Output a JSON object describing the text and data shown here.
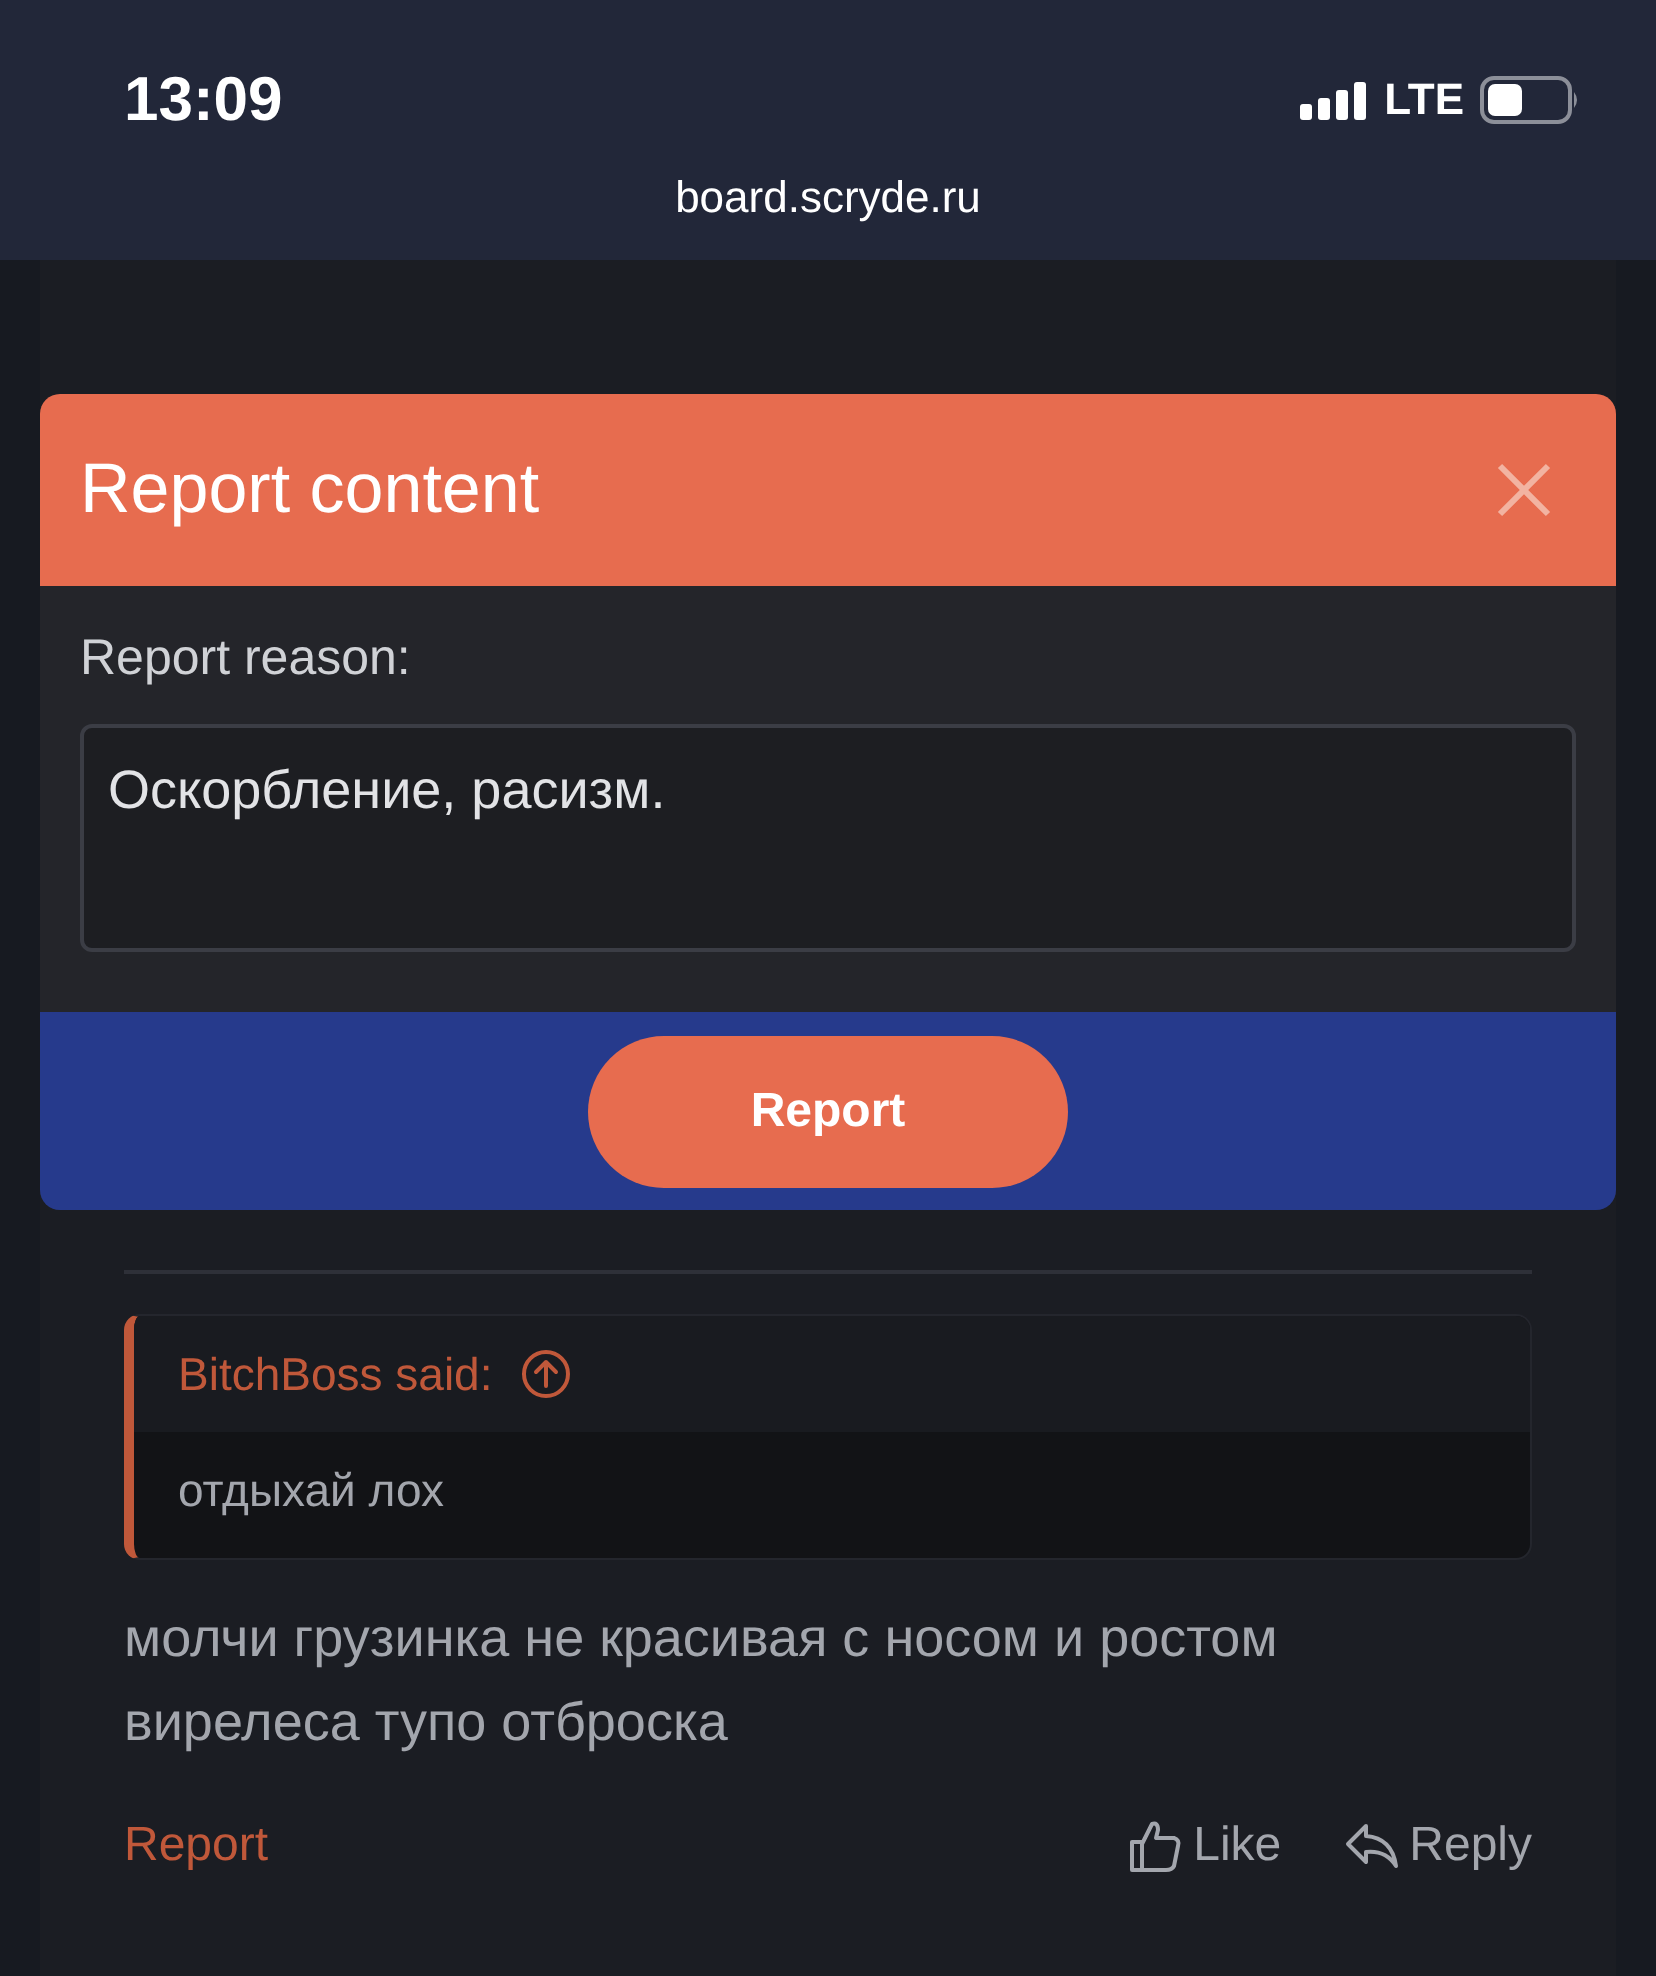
{
  "status_bar": {
    "time": "13:09",
    "network": "LTE"
  },
  "address_bar": {
    "url": "board.scryde.ru"
  },
  "post": {
    "quote": {
      "author": "BitchBoss said:",
      "text": "отдыхай лох"
    },
    "body": "молчи грузинка не красивая с носом и ростом вирелеса тупо отброска",
    "actions": {
      "report": "Report",
      "like": "Like",
      "reply": "Reply"
    }
  },
  "dialog": {
    "title": "Report content",
    "field_label": "Report reason:",
    "reason_value": "Оскорбление, расизм.",
    "submit": "Report"
  }
}
